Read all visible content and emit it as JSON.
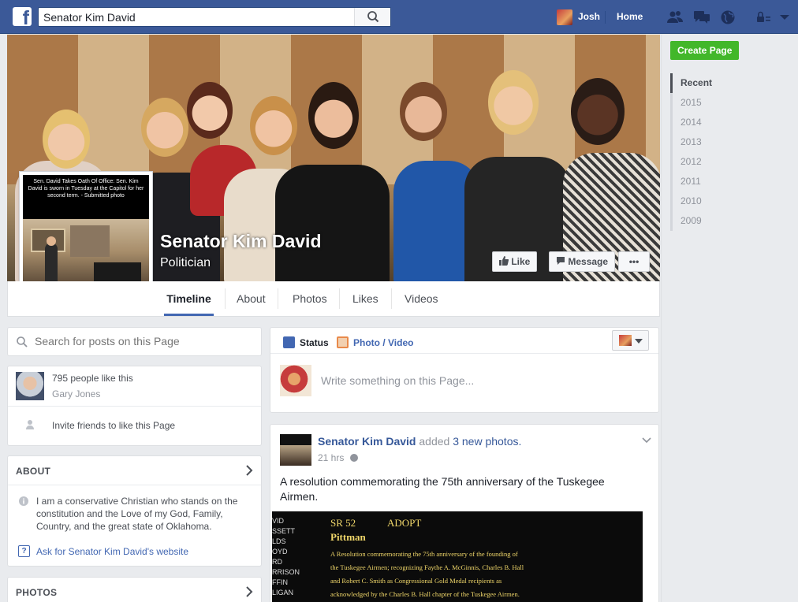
{
  "topbar": {
    "search_value": "Senator Kim David",
    "user_name": "Josh",
    "home_label": "Home"
  },
  "right_rail": {
    "create_page_label": "Create Page",
    "years": [
      "Recent",
      "2015",
      "2014",
      "2013",
      "2012",
      "2011",
      "2010",
      "2009"
    ]
  },
  "page": {
    "name": "Senator Kim David",
    "category": "Politician",
    "like_label": "Like",
    "message_label": "Message",
    "more_label": "•••",
    "profile_caption": "Sen. David Takes Oath Of Office: Sen. Kim David is sworn in Tuesday at the Capitol for her second term. - Submitted photo"
  },
  "tabs": [
    "Timeline",
    "About",
    "Photos",
    "Likes",
    "Videos"
  ],
  "left_column": {
    "search_placeholder": "Search for posts on this Page",
    "likes_count_text": "795 people like this",
    "liker_name": "Gary Jones",
    "invite_text": "Invite friends to like this Page",
    "about_header": "ABOUT",
    "about_text": "I am a conservative Christian who stands on the constitution and the Love of my God, Family, Country, and the great state of Oklahoma.",
    "website_link": "Ask for Senator Kim David's website",
    "photos_header": "PHOTOS"
  },
  "composer": {
    "status_label": "Status",
    "photo_video_label": "Photo / Video",
    "placeholder": "Write something on this Page..."
  },
  "post": {
    "author": "Senator Kim David",
    "action_text": "added",
    "action_link": "3 new photos.",
    "time": "21 hrs",
    "text": "A resolution commemorating the 75th anniversary of the Tuskegee Airmen.",
    "board_header": "SR 52",
    "board_status": "ADOPT",
    "board_sponsor": "Pittman",
    "board_lines": [
      "A Resolution commemorating the 75th anniversary of the founding of",
      "the Tuskegee Airmen; recognizing Faythe A. McGinnis, Charles B. Hall",
      "and Robert C. Smith as Congressional Gold Medal recipients as",
      "acknowledged by the Charles B. Hall chapter of the Tuskegee Airmen."
    ],
    "board_names": [
      "VID",
      "SSETT",
      "LDS",
      "OYD",
      "RD",
      "RRISON",
      "FFIN",
      "LIGAN"
    ]
  },
  "colors": {
    "brand": "#3b5998",
    "link": "#365899",
    "accent_green": "#42b72a",
    "page_bg": "#e9ebee"
  }
}
